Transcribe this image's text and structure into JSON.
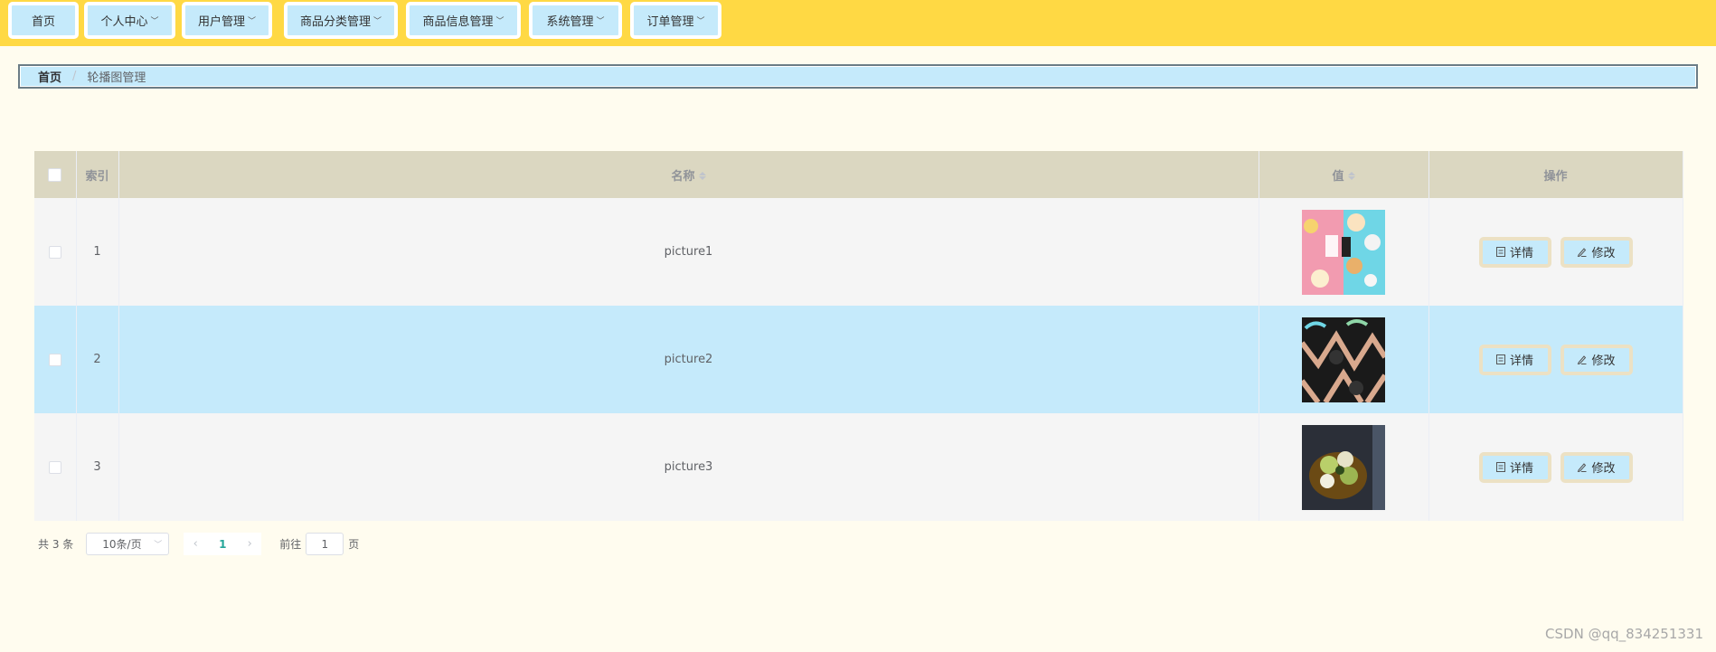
{
  "nav": {
    "items": [
      {
        "label": "首页",
        "has_dropdown": false
      },
      {
        "label": "个人中心",
        "has_dropdown": true
      },
      {
        "label": "用户管理",
        "has_dropdown": true
      },
      {
        "label": "商品分类管理",
        "has_dropdown": true
      },
      {
        "label": "商品信息管理",
        "has_dropdown": true
      },
      {
        "label": "系统管理",
        "has_dropdown": true
      },
      {
        "label": "订单管理",
        "has_dropdown": true
      }
    ]
  },
  "breadcrumb": {
    "home": "首页",
    "separator": "/",
    "current": "轮播图管理"
  },
  "table": {
    "headers": {
      "index": "索引",
      "name": "名称",
      "value": "值",
      "actions": "操作"
    },
    "rows": [
      {
        "index": "1",
        "name": "picture1",
        "highlighted": false
      },
      {
        "index": "2",
        "name": "picture2",
        "highlighted": true
      },
      {
        "index": "3",
        "name": "picture3",
        "highlighted": false
      }
    ],
    "detail_label": "详情",
    "edit_label": "修改"
  },
  "pagination": {
    "total_text": "共 3 条",
    "page_size": "10条/页",
    "current_page": "1",
    "goto_label": "前往",
    "goto_value": "1",
    "page_suffix": "页"
  },
  "watermark": "CSDN @qq_834251331",
  "colors": {
    "topbar": "#ffd944",
    "nav_item": "#c5eafb",
    "header_row": "#dbd7c1",
    "highlight_row": "#c5eafb",
    "page_bg": "#fffcef"
  }
}
